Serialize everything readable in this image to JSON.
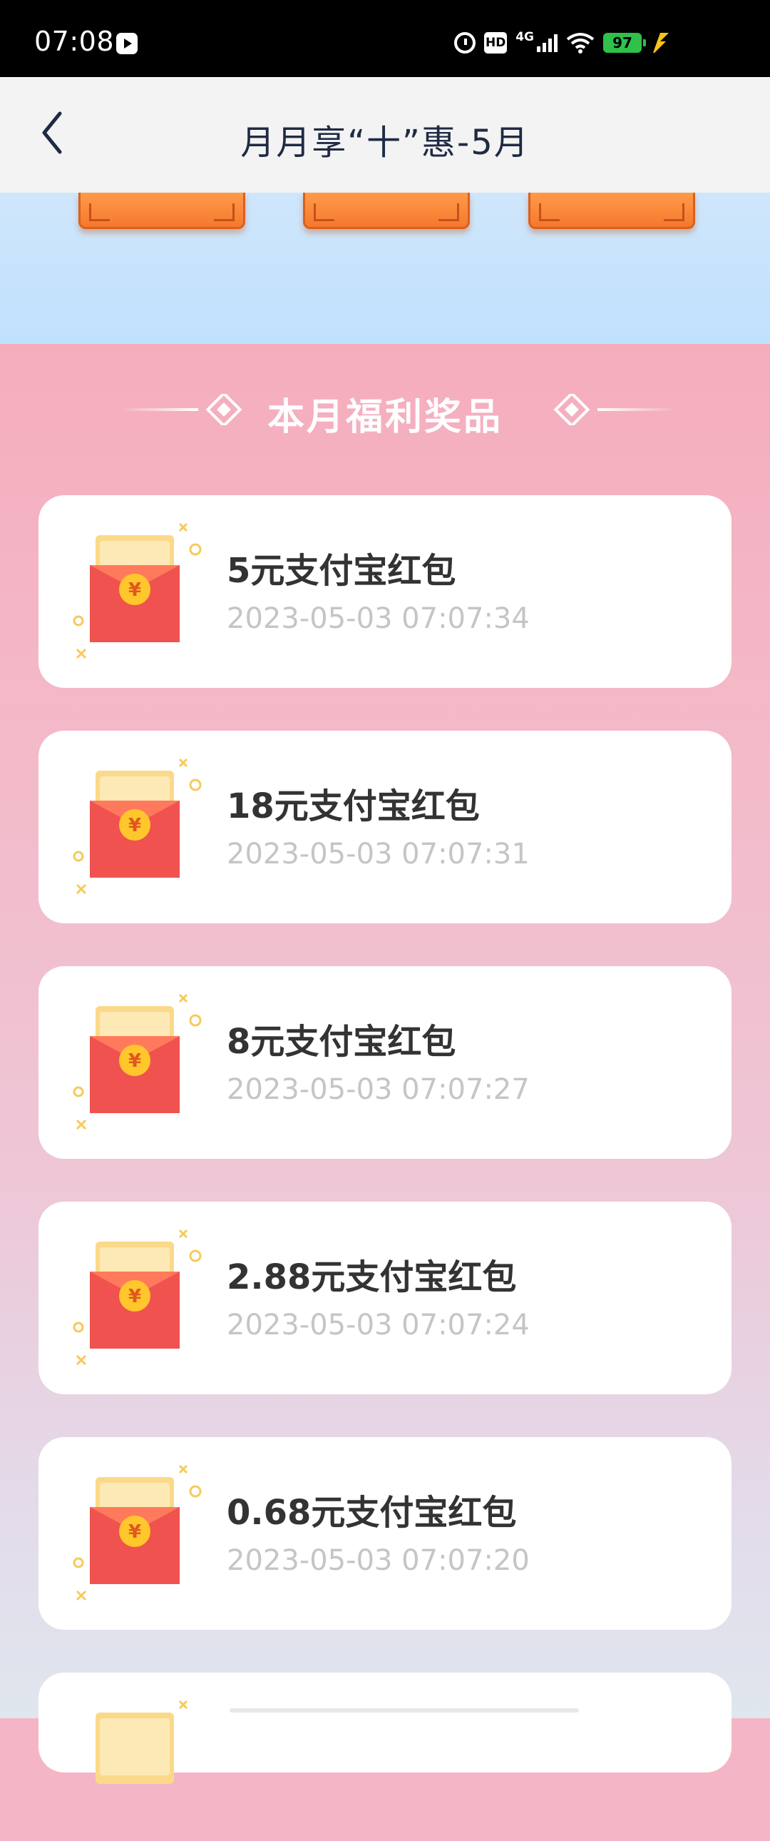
{
  "status_bar": {
    "time": "07:08",
    "network": "4G",
    "hd": "HD",
    "battery": "97"
  },
  "header": {
    "title": "月月享“十”惠-5月"
  },
  "section": {
    "title": "本月福利奖品"
  },
  "prizes": [
    {
      "title": "5元支付宝红包",
      "time": "2023-05-03 07:07:34"
    },
    {
      "title": "18元支付宝红包",
      "time": "2023-05-03 07:07:31"
    },
    {
      "title": "8元支付宝红包",
      "time": "2023-05-03 07:07:27"
    },
    {
      "title": "2.88元支付宝红包",
      "time": "2023-05-03 07:07:24"
    },
    {
      "title": "0.68元支付宝红包",
      "time": "2023-05-03 07:07:20"
    }
  ],
  "icons": {
    "back": "chevron-left-icon",
    "prize": "red-envelope-icon"
  },
  "colors": {
    "accent": "#f5782d",
    "title_text": "#1f2a44",
    "battery": "#2fc14a"
  }
}
